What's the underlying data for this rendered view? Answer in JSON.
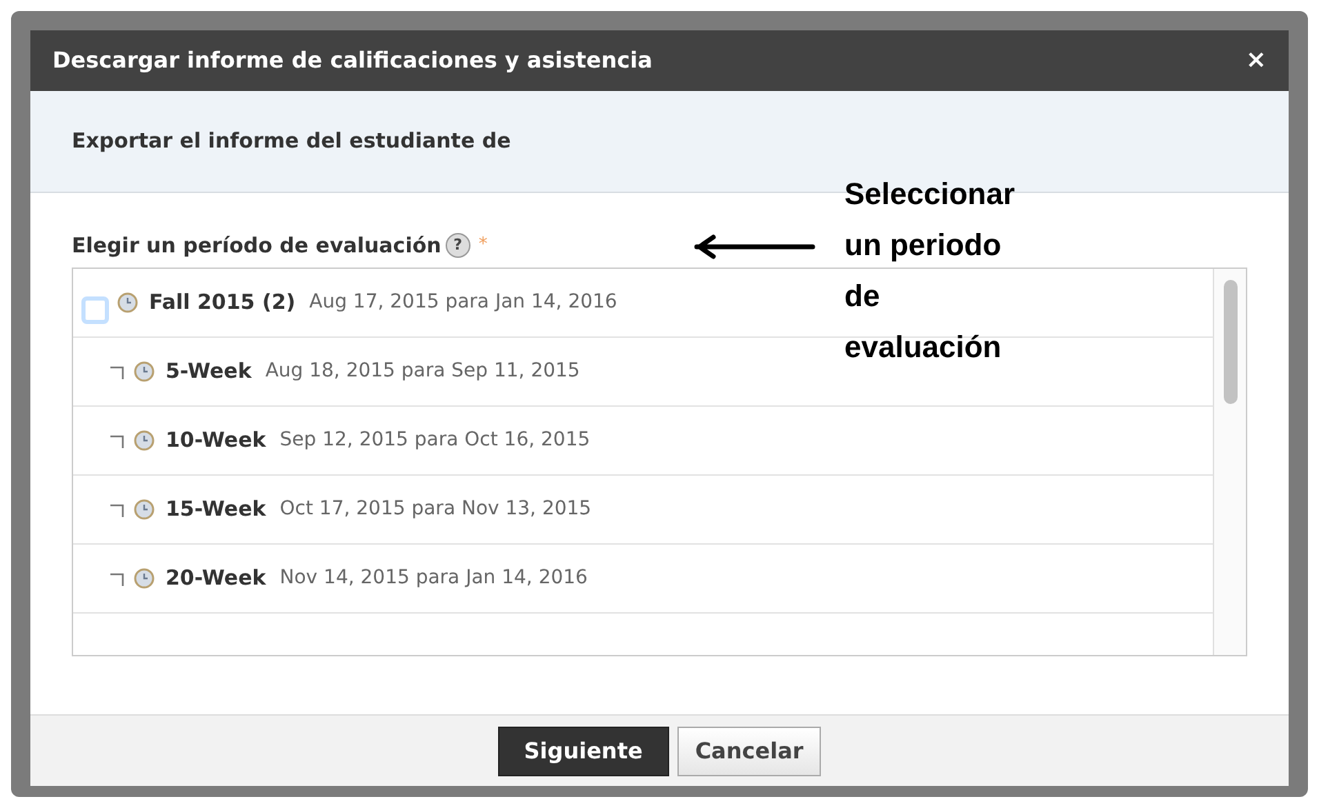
{
  "dialog": {
    "title": "Descargar informe de calificaciones y asistencia",
    "close": "×",
    "subheader": "Exportar el informe del estudiante de",
    "field_label": "Elegir un período de evaluación",
    "help": "?",
    "required_mark": "*",
    "periods": [
      {
        "name": "Fall 2015 (2)",
        "dates": "Aug 17, 2015 para Jan 14, 2016",
        "checked": false,
        "children": [
          {
            "name": "5-Week",
            "dates": "Aug 18, 2015 para Sep 11, 2015"
          },
          {
            "name": "10-Week",
            "dates": "Sep 12, 2015 para Oct 16, 2015"
          },
          {
            "name": "15-Week",
            "dates": "Oct 17, 2015 para Nov 13, 2015"
          },
          {
            "name": "20-Week",
            "dates": "Nov 14, 2015 para Jan 14, 2016"
          }
        ]
      }
    ],
    "buttons": [
      {
        "label": "Siguiente",
        "kind": "primary"
      },
      {
        "label": "Cancelar",
        "kind": "secondary"
      }
    ]
  },
  "annotation": {
    "text": "Seleccionar un periodo de evaluación"
  }
}
